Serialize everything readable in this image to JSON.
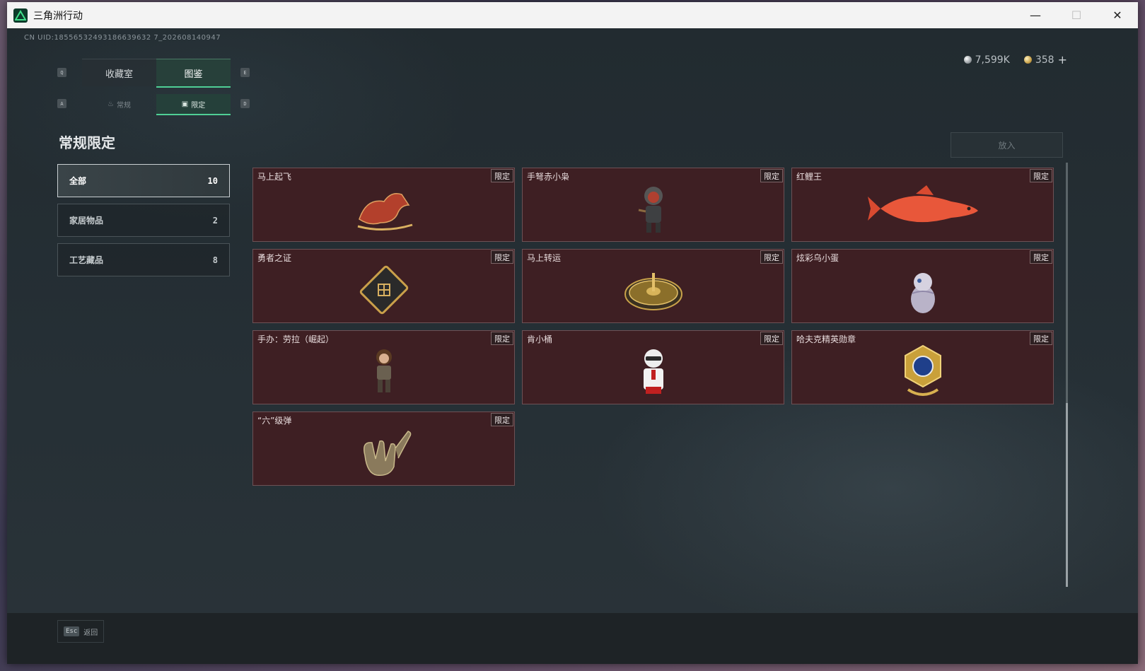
{
  "window": {
    "title": "三角洲行动",
    "minimize": "—",
    "maximize": "☐",
    "close": "✕"
  },
  "uid": "CN UID:18556532493186639632 7_202608140947",
  "currency": {
    "silver": "7,599K",
    "gold": "358",
    "plus": "+"
  },
  "tabs_main": {
    "key_left": "Q",
    "key_right": "E",
    "items": [
      {
        "label": "收藏室"
      },
      {
        "label": "图鉴"
      }
    ]
  },
  "tabs_sub": {
    "key_left": "A",
    "key_right": "D",
    "items": [
      {
        "label": "常规",
        "icon": "flame-icon"
      },
      {
        "label": "限定",
        "icon": "badge-icon"
      }
    ]
  },
  "page_title": "常规限定",
  "categories": [
    {
      "label": "全部",
      "count": "10"
    },
    {
      "label": "家居物品",
      "count": "2"
    },
    {
      "label": "工艺藏品",
      "count": "8"
    }
  ],
  "put_button": "放入",
  "badge_text": "限定",
  "items": [
    {
      "name": "马上起飞",
      "icon": "horse-icon"
    },
    {
      "name": "手弩赤小枭",
      "icon": "figure-icon"
    },
    {
      "name": "红鲤王",
      "icon": "fish-icon"
    },
    {
      "name": "勇者之证",
      "icon": "card-icon"
    },
    {
      "name": "马上转运",
      "icon": "wheel-icon"
    },
    {
      "name": "炫彩乌小蛋",
      "icon": "egg-icon"
    },
    {
      "name": "手办：劳拉（崛起）",
      "icon": "figurine-icon"
    },
    {
      "name": "肯小桶",
      "icon": "colonel-icon"
    },
    {
      "name": "哈夫克精英勋章",
      "icon": "medal-icon"
    },
    {
      "name": "“六”级弹",
      "icon": "hand-icon"
    }
  ],
  "footer": {
    "esc_key": "Esc",
    "esc_label": "返回"
  }
}
